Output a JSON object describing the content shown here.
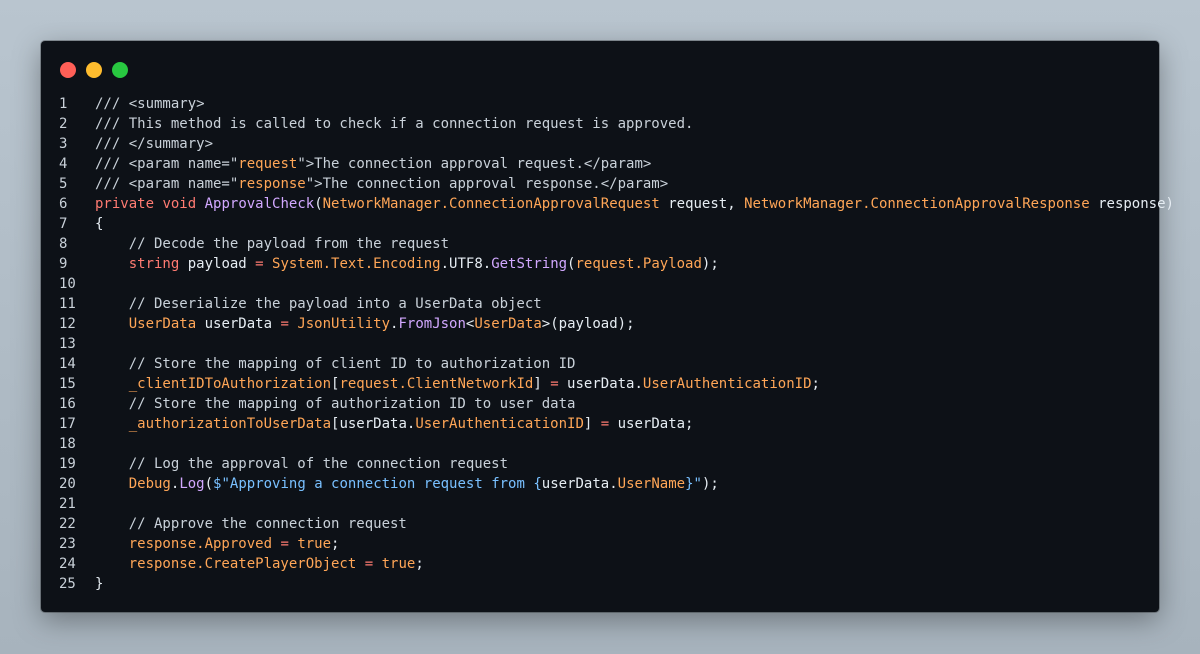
{
  "window": {
    "controls": {
      "close_color": "#ff5f57",
      "minimize_color": "#febc2e",
      "maximize_color": "#28c840"
    }
  },
  "theme": {
    "background": "#0d1117",
    "comment": "#c9d1d9",
    "keyword": "#ff7b72",
    "type": "#ffa657",
    "function": "#d2a8ff",
    "string": "#ffa657",
    "plain": "#e6edf3"
  },
  "code": {
    "lines": [
      {
        "n": "1",
        "tokens": [
          {
            "t": "comment",
            "v": "/// <summary>"
          }
        ]
      },
      {
        "n": "2",
        "tokens": [
          {
            "t": "comment",
            "v": "/// This method is called to check if a connection request is approved."
          }
        ]
      },
      {
        "n": "3",
        "tokens": [
          {
            "t": "comment",
            "v": "/// </summary>"
          }
        ]
      },
      {
        "n": "4",
        "tokens": [
          {
            "t": "comment",
            "v": "/// <param name=\""
          },
          {
            "t": "string",
            "v": "request"
          },
          {
            "t": "comment",
            "v": "\">The connection approval request.</param>"
          }
        ]
      },
      {
        "n": "5",
        "tokens": [
          {
            "t": "comment",
            "v": "/// <param name=\""
          },
          {
            "t": "string",
            "v": "response"
          },
          {
            "t": "comment",
            "v": "\">The connection approval response.</param>"
          }
        ]
      },
      {
        "n": "6",
        "tokens": [
          {
            "t": "keyword",
            "v": "private"
          },
          {
            "t": "plain",
            "v": " "
          },
          {
            "t": "keyword",
            "v": "void"
          },
          {
            "t": "plain",
            "v": " "
          },
          {
            "t": "func",
            "v": "ApprovalCheck"
          },
          {
            "t": "punct",
            "v": "("
          },
          {
            "t": "type",
            "v": "NetworkManager.ConnectionApprovalRequest"
          },
          {
            "t": "plain",
            "v": " request, "
          },
          {
            "t": "type",
            "v": "NetworkManager.ConnectionApprovalResponse"
          },
          {
            "t": "plain",
            "v": " response)"
          }
        ]
      },
      {
        "n": "7",
        "tokens": [
          {
            "t": "punct",
            "v": "{"
          }
        ]
      },
      {
        "n": "8",
        "tokens": [
          {
            "t": "comment",
            "v": "    // Decode the payload from the request"
          }
        ]
      },
      {
        "n": "9",
        "tokens": [
          {
            "t": "plain",
            "v": "    "
          },
          {
            "t": "keyword",
            "v": "string"
          },
          {
            "t": "plain",
            "v": " payload "
          },
          {
            "t": "keyword",
            "v": "="
          },
          {
            "t": "plain",
            "v": " "
          },
          {
            "t": "type",
            "v": "System.Text.Encoding"
          },
          {
            "t": "plain",
            "v": ".UTF8."
          },
          {
            "t": "func",
            "v": "GetString"
          },
          {
            "t": "punct",
            "v": "("
          },
          {
            "t": "prop",
            "v": "request.Payload"
          },
          {
            "t": "punct",
            "v": ");"
          }
        ]
      },
      {
        "n": "10",
        "tokens": [
          {
            "t": "plain",
            "v": ""
          }
        ]
      },
      {
        "n": "11",
        "tokens": [
          {
            "t": "comment",
            "v": "    // Deserialize the payload into a UserData object"
          }
        ]
      },
      {
        "n": "12",
        "tokens": [
          {
            "t": "plain",
            "v": "    "
          },
          {
            "t": "type",
            "v": "UserData"
          },
          {
            "t": "plain",
            "v": " userData "
          },
          {
            "t": "keyword",
            "v": "="
          },
          {
            "t": "plain",
            "v": " "
          },
          {
            "t": "type",
            "v": "JsonUtility"
          },
          {
            "t": "plain",
            "v": "."
          },
          {
            "t": "func",
            "v": "FromJson"
          },
          {
            "t": "punct",
            "v": "<"
          },
          {
            "t": "type",
            "v": "UserData"
          },
          {
            "t": "punct",
            "v": ">(payload);"
          }
        ]
      },
      {
        "n": "13",
        "tokens": [
          {
            "t": "plain",
            "v": ""
          }
        ]
      },
      {
        "n": "14",
        "tokens": [
          {
            "t": "comment",
            "v": "    // Store the mapping of client ID to authorization ID"
          }
        ]
      },
      {
        "n": "15",
        "tokens": [
          {
            "t": "plain",
            "v": "    "
          },
          {
            "t": "prop",
            "v": "_clientIDToAuthorization"
          },
          {
            "t": "punct",
            "v": "["
          },
          {
            "t": "prop",
            "v": "request.ClientNetworkId"
          },
          {
            "t": "punct",
            "v": "] "
          },
          {
            "t": "keyword",
            "v": "="
          },
          {
            "t": "plain",
            "v": " userData."
          },
          {
            "t": "prop",
            "v": "UserAuthenticationID"
          },
          {
            "t": "punct",
            "v": ";"
          }
        ]
      },
      {
        "n": "16",
        "tokens": [
          {
            "t": "comment",
            "v": "    // Store the mapping of authorization ID to user data"
          }
        ]
      },
      {
        "n": "17",
        "tokens": [
          {
            "t": "plain",
            "v": "    "
          },
          {
            "t": "prop",
            "v": "_authorizationToUserData"
          },
          {
            "t": "punct",
            "v": "["
          },
          {
            "t": "plain",
            "v": "userData."
          },
          {
            "t": "prop",
            "v": "UserAuthenticationID"
          },
          {
            "t": "punct",
            "v": "] "
          },
          {
            "t": "keyword",
            "v": "="
          },
          {
            "t": "plain",
            "v": " userData;"
          }
        ]
      },
      {
        "n": "18",
        "tokens": [
          {
            "t": "plain",
            "v": ""
          }
        ]
      },
      {
        "n": "19",
        "tokens": [
          {
            "t": "comment",
            "v": "    // Log the approval of the connection request"
          }
        ]
      },
      {
        "n": "20",
        "tokens": [
          {
            "t": "plain",
            "v": "    "
          },
          {
            "t": "type",
            "v": "Debug"
          },
          {
            "t": "plain",
            "v": "."
          },
          {
            "t": "func",
            "v": "Log"
          },
          {
            "t": "punct",
            "v": "("
          },
          {
            "t": "interp",
            "v": "$\"Approving a connection request from {"
          },
          {
            "t": "plain",
            "v": "userData."
          },
          {
            "t": "prop",
            "v": "UserName"
          },
          {
            "t": "interp",
            "v": "}\""
          },
          {
            "t": "punct",
            "v": ");"
          }
        ]
      },
      {
        "n": "21",
        "tokens": [
          {
            "t": "plain",
            "v": ""
          }
        ]
      },
      {
        "n": "22",
        "tokens": [
          {
            "t": "comment",
            "v": "    // Approve the connection request"
          }
        ]
      },
      {
        "n": "23",
        "tokens": [
          {
            "t": "plain",
            "v": "    "
          },
          {
            "t": "prop",
            "v": "response.Approved"
          },
          {
            "t": "plain",
            "v": " "
          },
          {
            "t": "keyword",
            "v": "="
          },
          {
            "t": "plain",
            "v": " "
          },
          {
            "t": "string",
            "v": "true"
          },
          {
            "t": "punct",
            "v": ";"
          }
        ]
      },
      {
        "n": "24",
        "tokens": [
          {
            "t": "plain",
            "v": "    "
          },
          {
            "t": "prop",
            "v": "response.CreatePlayerObject"
          },
          {
            "t": "plain",
            "v": " "
          },
          {
            "t": "keyword",
            "v": "="
          },
          {
            "t": "plain",
            "v": " "
          },
          {
            "t": "string",
            "v": "true"
          },
          {
            "t": "punct",
            "v": ";"
          }
        ]
      },
      {
        "n": "25",
        "tokens": [
          {
            "t": "punct",
            "v": "}"
          }
        ]
      }
    ]
  }
}
